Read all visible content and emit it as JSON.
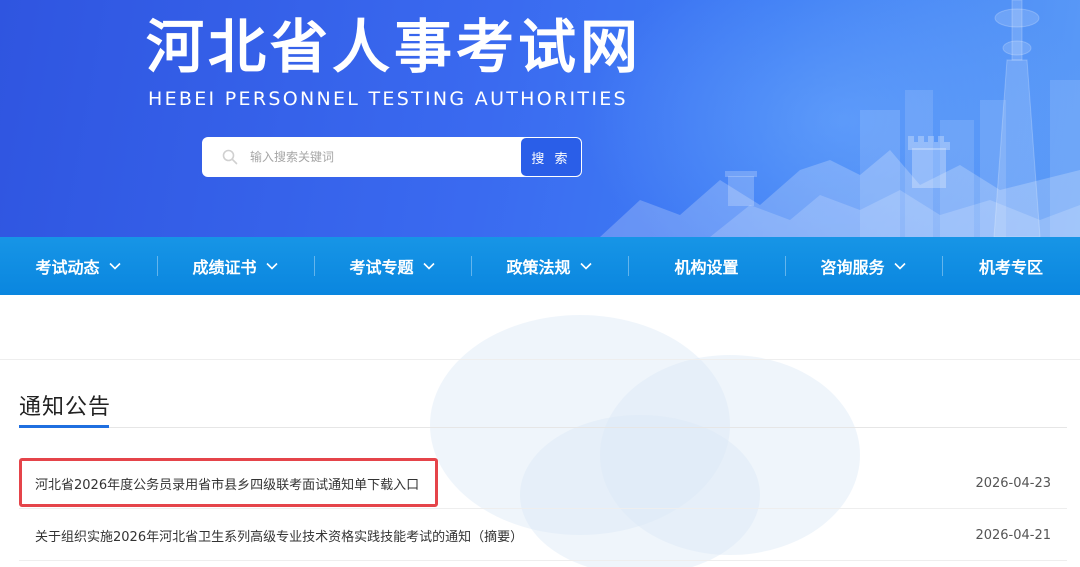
{
  "header": {
    "title_cn": "河北省人事考试网",
    "title_en": "HEBEI PERSONNEL TESTING AUTHORITIES"
  },
  "search": {
    "placeholder": "输入搜索关键词",
    "button_label": "搜 索",
    "icon": "search-icon"
  },
  "nav": {
    "items": [
      {
        "label": "考试动态",
        "has_dropdown": true
      },
      {
        "label": "成绩证书",
        "has_dropdown": true
      },
      {
        "label": "考试专题",
        "has_dropdown": true
      },
      {
        "label": "政策法规",
        "has_dropdown": true
      },
      {
        "label": "机构设置",
        "has_dropdown": false
      },
      {
        "label": "咨询服务",
        "has_dropdown": true
      },
      {
        "label": "机考专区",
        "has_dropdown": false
      }
    ]
  },
  "notices": {
    "section_title": "通知公告",
    "items": [
      {
        "title": "河北省2026年度公务员录用省市县乡四级联考面试通知单下载入口",
        "date": "2026-04-23",
        "highlighted": true
      },
      {
        "title": "关于组织实施2026年河北省卫生系列高级专业技术资格实践技能考试的通知（摘要）",
        "date": "2026-04-21",
        "highlighted": false
      }
    ]
  },
  "colors": {
    "banner_blue": "#3a6af0",
    "nav_blue": "#0a86df",
    "accent_blue": "#1f6fe0",
    "highlight_red": "#e5444a"
  }
}
